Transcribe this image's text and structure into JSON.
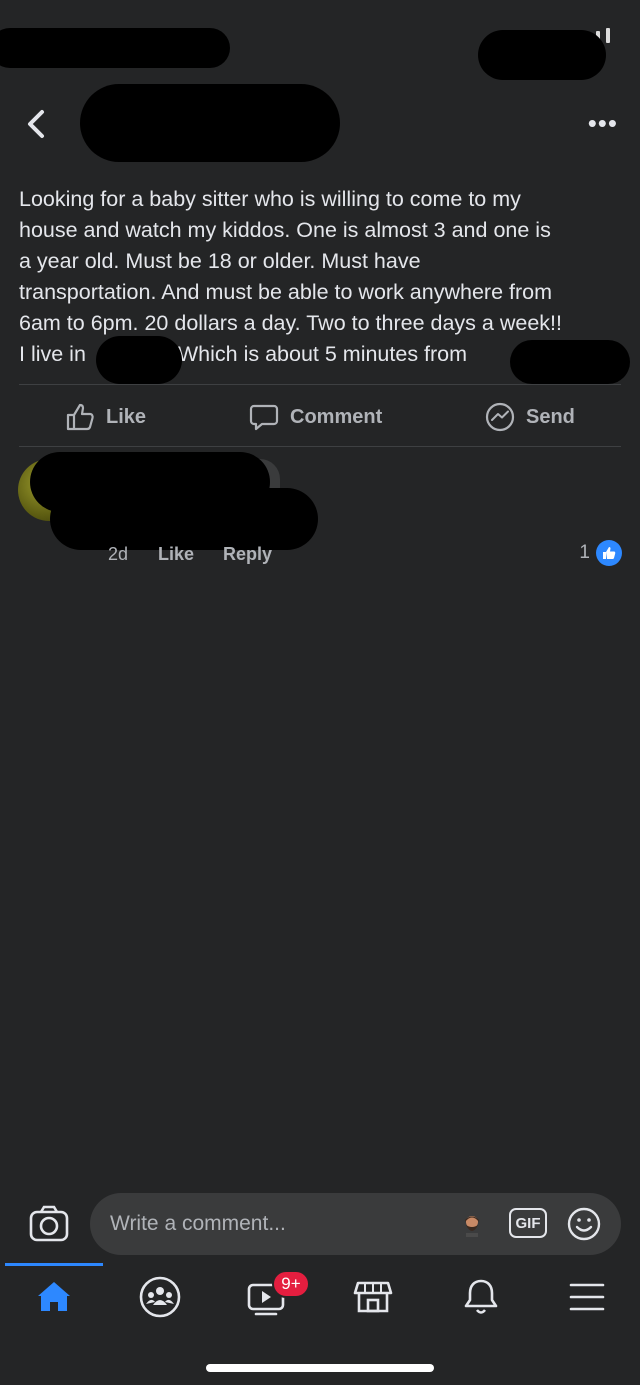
{
  "post": {
    "lines": [
      "Looking for a baby sitter who is willing to come to my",
      "house and watch my kiddos. One is almost 3 and one is",
      "a year old. Must be 18 or older. Must have",
      "transportation. And must be able to work anywhere from",
      "6am to 6pm. 20 dollars a day. Two to three days a week!!"
    ],
    "last_line_a": "I live in",
    "last_line_b": "! Which is about 5 minutes from"
  },
  "actions": {
    "like": "Like",
    "comment": "Comment",
    "send": "Send"
  },
  "comment": {
    "age": "2d",
    "like": "Like",
    "reply": "Reply",
    "reaction_count": "1"
  },
  "composer": {
    "placeholder": "Write a comment...",
    "gif": "GIF"
  },
  "tabs": {
    "items": [
      "home-icon",
      "groups-icon",
      "watch-icon",
      "marketplace-icon",
      "notifications-icon",
      "menu-icon"
    ],
    "watch_badge": "9+"
  },
  "colors": {
    "background": "#242526",
    "accent": "#2d88ff",
    "badge": "#e41e3f",
    "bubble": "#3a3b3c"
  }
}
